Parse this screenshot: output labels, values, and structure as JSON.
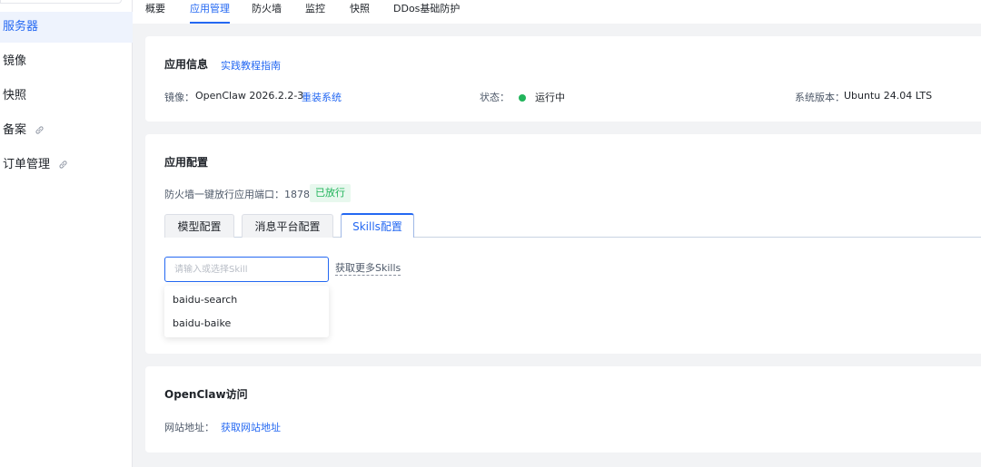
{
  "sidebar": {
    "items": [
      {
        "label": "服务器",
        "active": true,
        "external": false
      },
      {
        "label": "镜像",
        "active": false,
        "external": false
      },
      {
        "label": "快照",
        "active": false,
        "external": false
      },
      {
        "label": "备案",
        "active": false,
        "external": true
      },
      {
        "label": "订单管理",
        "active": false,
        "external": true
      }
    ]
  },
  "topnav": {
    "tabs": [
      "概要",
      "应用管理",
      "防火墙",
      "监控",
      "快照",
      "DDos基础防护"
    ],
    "active": "应用管理"
  },
  "app_info": {
    "title": "应用信息",
    "guide_link": "实践教程指南",
    "image_label": "镜像：",
    "image_value": "OpenClaw 2026.2.2-3",
    "reinstall_link": "重装系统",
    "status_label": "状态：",
    "status_value": "运行中",
    "os_label": "系统版本：",
    "os_value": "Ubuntu 24.04 LTS"
  },
  "app_config": {
    "title": "应用配置",
    "firewall_text": "防火墙一键放行应用端口：18789",
    "firewall_tag": "已放行",
    "tabs": [
      "模型配置",
      "消息平台配置",
      "Skills配置"
    ],
    "active_tab": "Skills配置",
    "skill_input_placeholder": "请输入或选择Skill",
    "more_skills_link": "获取更多Skills",
    "skill_options": [
      "baidu-search",
      "baidu-baike"
    ]
  },
  "openclaw_access": {
    "title": "OpenClaw访问",
    "site_label": "网站地址：",
    "site_link": "获取网站地址"
  },
  "colors": {
    "accent": "#2468f2",
    "status_green": "#21b45b",
    "page_bg": "#f2f3f5"
  },
  "icons": {
    "external_link": "link-icon"
  }
}
